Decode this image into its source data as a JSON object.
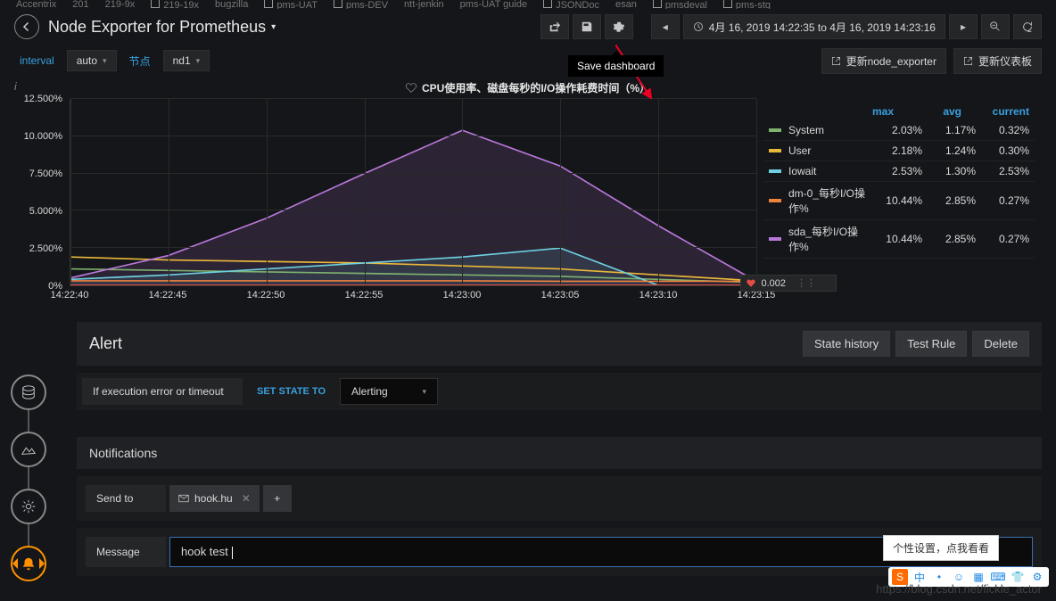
{
  "bookmarks": [
    "Accentrix",
    "201",
    "219-9x",
    "219-19x",
    "bugzilla",
    "pms-UAT",
    "pms-DEV",
    "ntt-jenkin",
    "pms-UAT guide",
    "JSONDoc",
    "esan",
    "pmsdeval",
    "pms-stg"
  ],
  "header": {
    "title": "Node Exporter for Prometheus"
  },
  "toolbar": {
    "tooltip": "Save dashboard"
  },
  "time_range": "4月 16, 2019 14:22:35 to 4月 16, 2019 14:23:16",
  "vars": {
    "interval_label": "interval",
    "interval_value": "auto",
    "node_label": "节点",
    "node_value": "nd1",
    "link1": "更新node_exporter",
    "link2": "更新仪表板"
  },
  "panel": {
    "title": "CPU使用率、磁盘每秒的I/O操作耗费时间（%）"
  },
  "chart_data": {
    "type": "line",
    "ylim": [
      0,
      12.5
    ],
    "ylabels": [
      "0%",
      "2.500%",
      "5.000%",
      "7.500%",
      "10.000%",
      "12.500%"
    ],
    "x": [
      "14:22:40",
      "14:22:45",
      "14:22:50",
      "14:22:55",
      "14:23:00",
      "14:23:05",
      "14:23:10",
      "14:23:15"
    ],
    "threshold": 0.002,
    "series": [
      {
        "name": "System",
        "color": "#7eb26d",
        "values": [
          1.1,
          1.0,
          0.9,
          0.8,
          0.7,
          0.6,
          0.4,
          0.2
        ]
      },
      {
        "name": "User",
        "color": "#eab839",
        "values": [
          1.9,
          1.7,
          1.6,
          1.5,
          1.3,
          1.1,
          0.7,
          0.3
        ]
      },
      {
        "name": "Iowait",
        "color": "#6ed0e0",
        "values": [
          0.4,
          0.7,
          1.1,
          1.5,
          1.9,
          2.5,
          0.0,
          0.0
        ]
      },
      {
        "name": "dm-0_每秒I/O操作%",
        "color": "#ef843c",
        "values": [
          0.3,
          0.3,
          0.3,
          0.3,
          0.3,
          0.27,
          0.27,
          0.27
        ]
      },
      {
        "name": "sda_每秒I/O操作%",
        "color": "#b877d9",
        "values": [
          0.5,
          2.0,
          4.5,
          7.5,
          10.4,
          8.0,
          4.0,
          0.27
        ]
      }
    ]
  },
  "legend": {
    "headers": [
      "max",
      "avg",
      "current"
    ],
    "rows": [
      {
        "name": "System",
        "color": "#7eb26d",
        "max": "2.03%",
        "avg": "1.17%",
        "current": "0.32%"
      },
      {
        "name": "User",
        "color": "#eab839",
        "max": "2.18%",
        "avg": "1.24%",
        "current": "0.30%"
      },
      {
        "name": "Iowait",
        "color": "#6ed0e0",
        "max": "2.53%",
        "avg": "1.30%",
        "current": "2.53%"
      },
      {
        "name": "dm-0_每秒I/O操作%",
        "color": "#ef843c",
        "max": "10.44%",
        "avg": "2.85%",
        "current": "0.27%"
      },
      {
        "name": "sda_每秒I/O操作%",
        "color": "#b877d9",
        "max": "10.44%",
        "avg": "2.85%",
        "current": "0.27%"
      }
    ]
  },
  "alert": {
    "heading": "Alert",
    "buttons": {
      "history": "State history",
      "test": "Test Rule",
      "delete": "Delete"
    },
    "if_error_label": "If execution error or timeout",
    "set_state_label": "SET STATE TO",
    "set_state_value": "Alerting",
    "notifications_label": "Notifications",
    "send_to_label": "Send to",
    "send_to_chip": "hook.hu",
    "message_label": "Message",
    "message_value": "hook test"
  },
  "floating_tip": "个性设置，点我看看",
  "watermark_url": "https://blog.csdn.net/fickle_actor"
}
